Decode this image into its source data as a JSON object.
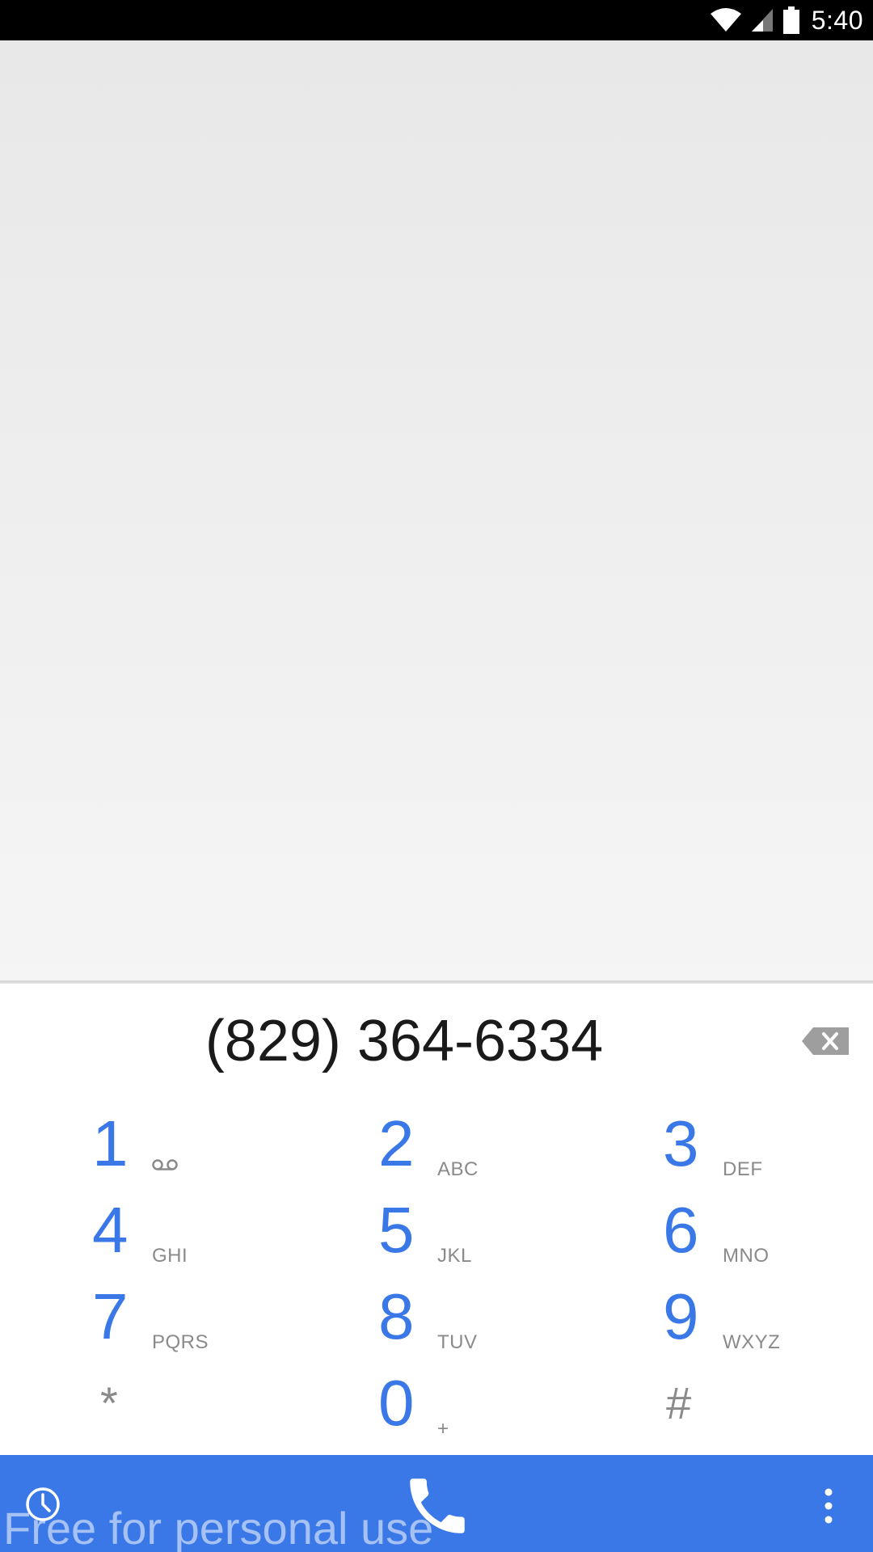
{
  "status_bar": {
    "time": "5:40",
    "icons": [
      "wifi-icon",
      "cell-signal-icon",
      "battery-icon"
    ]
  },
  "dialer": {
    "number": "(829) 364-6334",
    "keys": [
      {
        "digit": "1",
        "letters": "",
        "icon": "voicemail-icon"
      },
      {
        "digit": "2",
        "letters": "ABC"
      },
      {
        "digit": "3",
        "letters": "DEF"
      },
      {
        "digit": "4",
        "letters": "GHI"
      },
      {
        "digit": "5",
        "letters": "JKL"
      },
      {
        "digit": "6",
        "letters": "MNO"
      },
      {
        "digit": "7",
        "letters": "PQRS"
      },
      {
        "digit": "8",
        "letters": "TUV"
      },
      {
        "digit": "9",
        "letters": "WXYZ"
      },
      {
        "digit": "*",
        "letters": ""
      },
      {
        "digit": "0",
        "letters": "+"
      },
      {
        "digit": "#",
        "letters": ""
      }
    ]
  },
  "action_bar": {
    "icons": [
      "history-icon",
      "phone-icon",
      "overflow-menu-icon"
    ]
  },
  "watermark": "Free for personal use",
  "colors": {
    "accent": "#3b78e7",
    "content_bg": "#efefef",
    "digit_text": "#1a1a1a",
    "letters": "#8a8a8a"
  }
}
